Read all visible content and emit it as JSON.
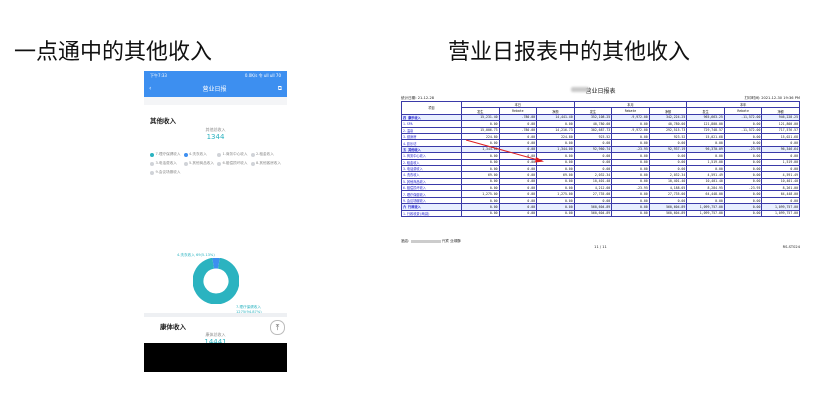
{
  "headings": {
    "left": "一点通中的其他收入",
    "right": "营业日报表中的其他收入"
  },
  "phone": {
    "status_left": "下午7:33",
    "status_right": "0.0K/s 令 ull ull 70",
    "nav_title": "营业日报",
    "back_icon": "back-arrow-icon",
    "share_icon": "share-icon",
    "other_income": {
      "title": "其他收入",
      "total_label": "其他总收入",
      "total_value": "1344",
      "legend": [
        {
          "label": "7.理疗保健收入",
          "color": "#2bb3c0"
        },
        {
          "label": "4.洗衣收入",
          "color": "#3d8ff0"
        },
        {
          "label": "1.商务中心收入",
          "color": "#d0d3d8"
        },
        {
          "label": "2.租金收入",
          "color": "#d0d3d8"
        },
        {
          "label": "3.电话费收入",
          "color": "#d0d3d8"
        },
        {
          "label": "5.其他商品收入",
          "color": "#d0d3d8"
        },
        {
          "label": "6.赔偿损坏收入",
          "color": "#d0d3d8"
        },
        {
          "label": "8.其他客房收入",
          "color": "#d0d3d8"
        },
        {
          "label": "9.会议场服收入",
          "color": "#d0d3d8"
        }
      ],
      "slices": [
        {
          "label": "4.洗衣收入",
          "value": 69,
          "pct": "5.13%",
          "color": "#3d8ff0"
        },
        {
          "label": "7.理疗保健收入",
          "value": 1275,
          "pct": "94.87%",
          "color": "#2bb3c0"
        }
      ],
      "annotation_a": "4.洗衣收入 69(5.13%)",
      "annotation_b": "7.理疗保健收入 1275(94.87%)"
    },
    "kangti": {
      "title": "康体收入",
      "total_label": "康体总收入",
      "total_value": "14441"
    },
    "top_button": "下"
  },
  "report": {
    "title": "营业日报表",
    "date_label": "统计日期: 21-12-28",
    "print_date": "打印时间: 2021-12-30 19:36 PM",
    "col_groups": [
      "本日",
      "本月",
      "本年"
    ],
    "col_headers": [
      "发生",
      "Rebate",
      "净额",
      "发生",
      "Rebate",
      "净额",
      "发生",
      "Rebate",
      "净额"
    ],
    "item_header": "项目",
    "rows": [
      {
        "name": "四 康乐收入",
        "v": [
          "15,231.40",
          "-780.00",
          "14,441.40",
          "352,108.25",
          "-9,972.00",
          "342,224.25",
          "965,663.25",
          "-11,572.00",
          "946,228.25"
        ],
        "hi": true,
        "sec": true
      },
      {
        "name": "1.SPA",
        "v": [
          "0.00",
          "0.00",
          "0.00",
          "40,780.00",
          "0.00",
          "40,780.00",
          "121,800.00",
          "0.00",
          "121,800.00"
        ]
      },
      {
        "name": "2.温泉",
        "v": [
          "15,006.73",
          "-780.00",
          "14,216.73",
          "302,687.73",
          "-9,972.00",
          "292,515.73",
          "729,748.57",
          "-11,572.00",
          "717,576.57"
        ]
      },
      {
        "name": "3.健身房",
        "v": [
          "224.80",
          "0.00",
          "224.80",
          "923.52",
          "0.00",
          "923.52",
          "15,021.68",
          "0.00",
          "15,021.68"
        ]
      },
      {
        "name": "4.影乐坊",
        "v": [
          "0.00",
          "0.00",
          "0.00",
          "0.00",
          "0.00",
          "0.00",
          "0.00",
          "0.00",
          "0.00"
        ]
      },
      {
        "name": "五 其他收入",
        "v": [
          "1,344.00",
          "0.00",
          "1,344.00",
          "92,960.74",
          "-23.95",
          "92,937.19",
          "96,370.09",
          "-23.95",
          "96,346.64"
        ],
        "hi": true,
        "sec": true
      },
      {
        "name": "1.商务中心收入",
        "v": [
          "0.00",
          "0.00",
          "0.00",
          "0.00",
          "0.00",
          "0.00",
          "0.00",
          "0.00",
          "0.00"
        ]
      },
      {
        "name": "2.租金收入",
        "v": [
          "0.00",
          "0.00",
          "0.00",
          "0.00",
          "0.00",
          "0.00",
          "1,519.00",
          "0.00",
          "1,519.00"
        ]
      },
      {
        "name": "3.电话费收入",
        "v": [
          "0.00",
          "0.00",
          "0.00",
          "0.00",
          "0.00",
          "0.00",
          "0.00",
          "0.00",
          "0.00"
        ]
      },
      {
        "name": "4.洗衣收入",
        "v": [
          "69.00",
          "0.00",
          "69.00",
          "2,032.34",
          "0.00",
          "2,032.34",
          "4,591.49",
          "0.00",
          "4,591.49"
        ]
      },
      {
        "name": "5.其他商品收入",
        "v": [
          "0.00",
          "0.00",
          "0.00",
          "10,401.40",
          "0.00",
          "10,401.40",
          "10,401.40",
          "0.00",
          "10,401.40"
        ]
      },
      {
        "name": "6.赔偿损坏收入",
        "v": [
          "0.00",
          "0.00",
          "0.00",
          "4,212.00",
          "-23.95",
          "4,188.05",
          "8,284.95",
          "-23.95",
          "8,261.00"
        ]
      },
      {
        "name": "7.理疗保健收入",
        "v": [
          "1,275.00",
          "0.00",
          "1,275.00",
          "27,735.00",
          "0.00",
          "27,735.00",
          "64,448.00",
          "0.00",
          "64,448.00"
        ]
      },
      {
        "name": "9.会议场服收入",
        "v": [
          "0.00",
          "0.00",
          "0.00",
          "0.00",
          "0.00",
          "0.00",
          "0.00",
          "0.00",
          "0.00"
        ]
      },
      {
        "name": "六 行政收入",
        "v": [
          "0.00",
          "0.00",
          "0.00",
          "560,604.89",
          "0.00",
          "560,604.89",
          "1,099,757.00",
          "0.00",
          "1,099,757.00"
        ],
        "hi": true,
        "sec": true
      },
      {
        "name": "1.行政收费(两减)",
        "v": [
          "0.00",
          "0.00",
          "0.00",
          "560,604.89",
          "0.00",
          "560,604.89",
          "1,099,757.00",
          "0.00",
          "1,099,757.00"
        ]
      }
    ],
    "footer_left": "酒店:",
    "footer_left2": "兴宾 业绿酥",
    "page": "11 / 11",
    "footer_right": "RS-ST024"
  }
}
